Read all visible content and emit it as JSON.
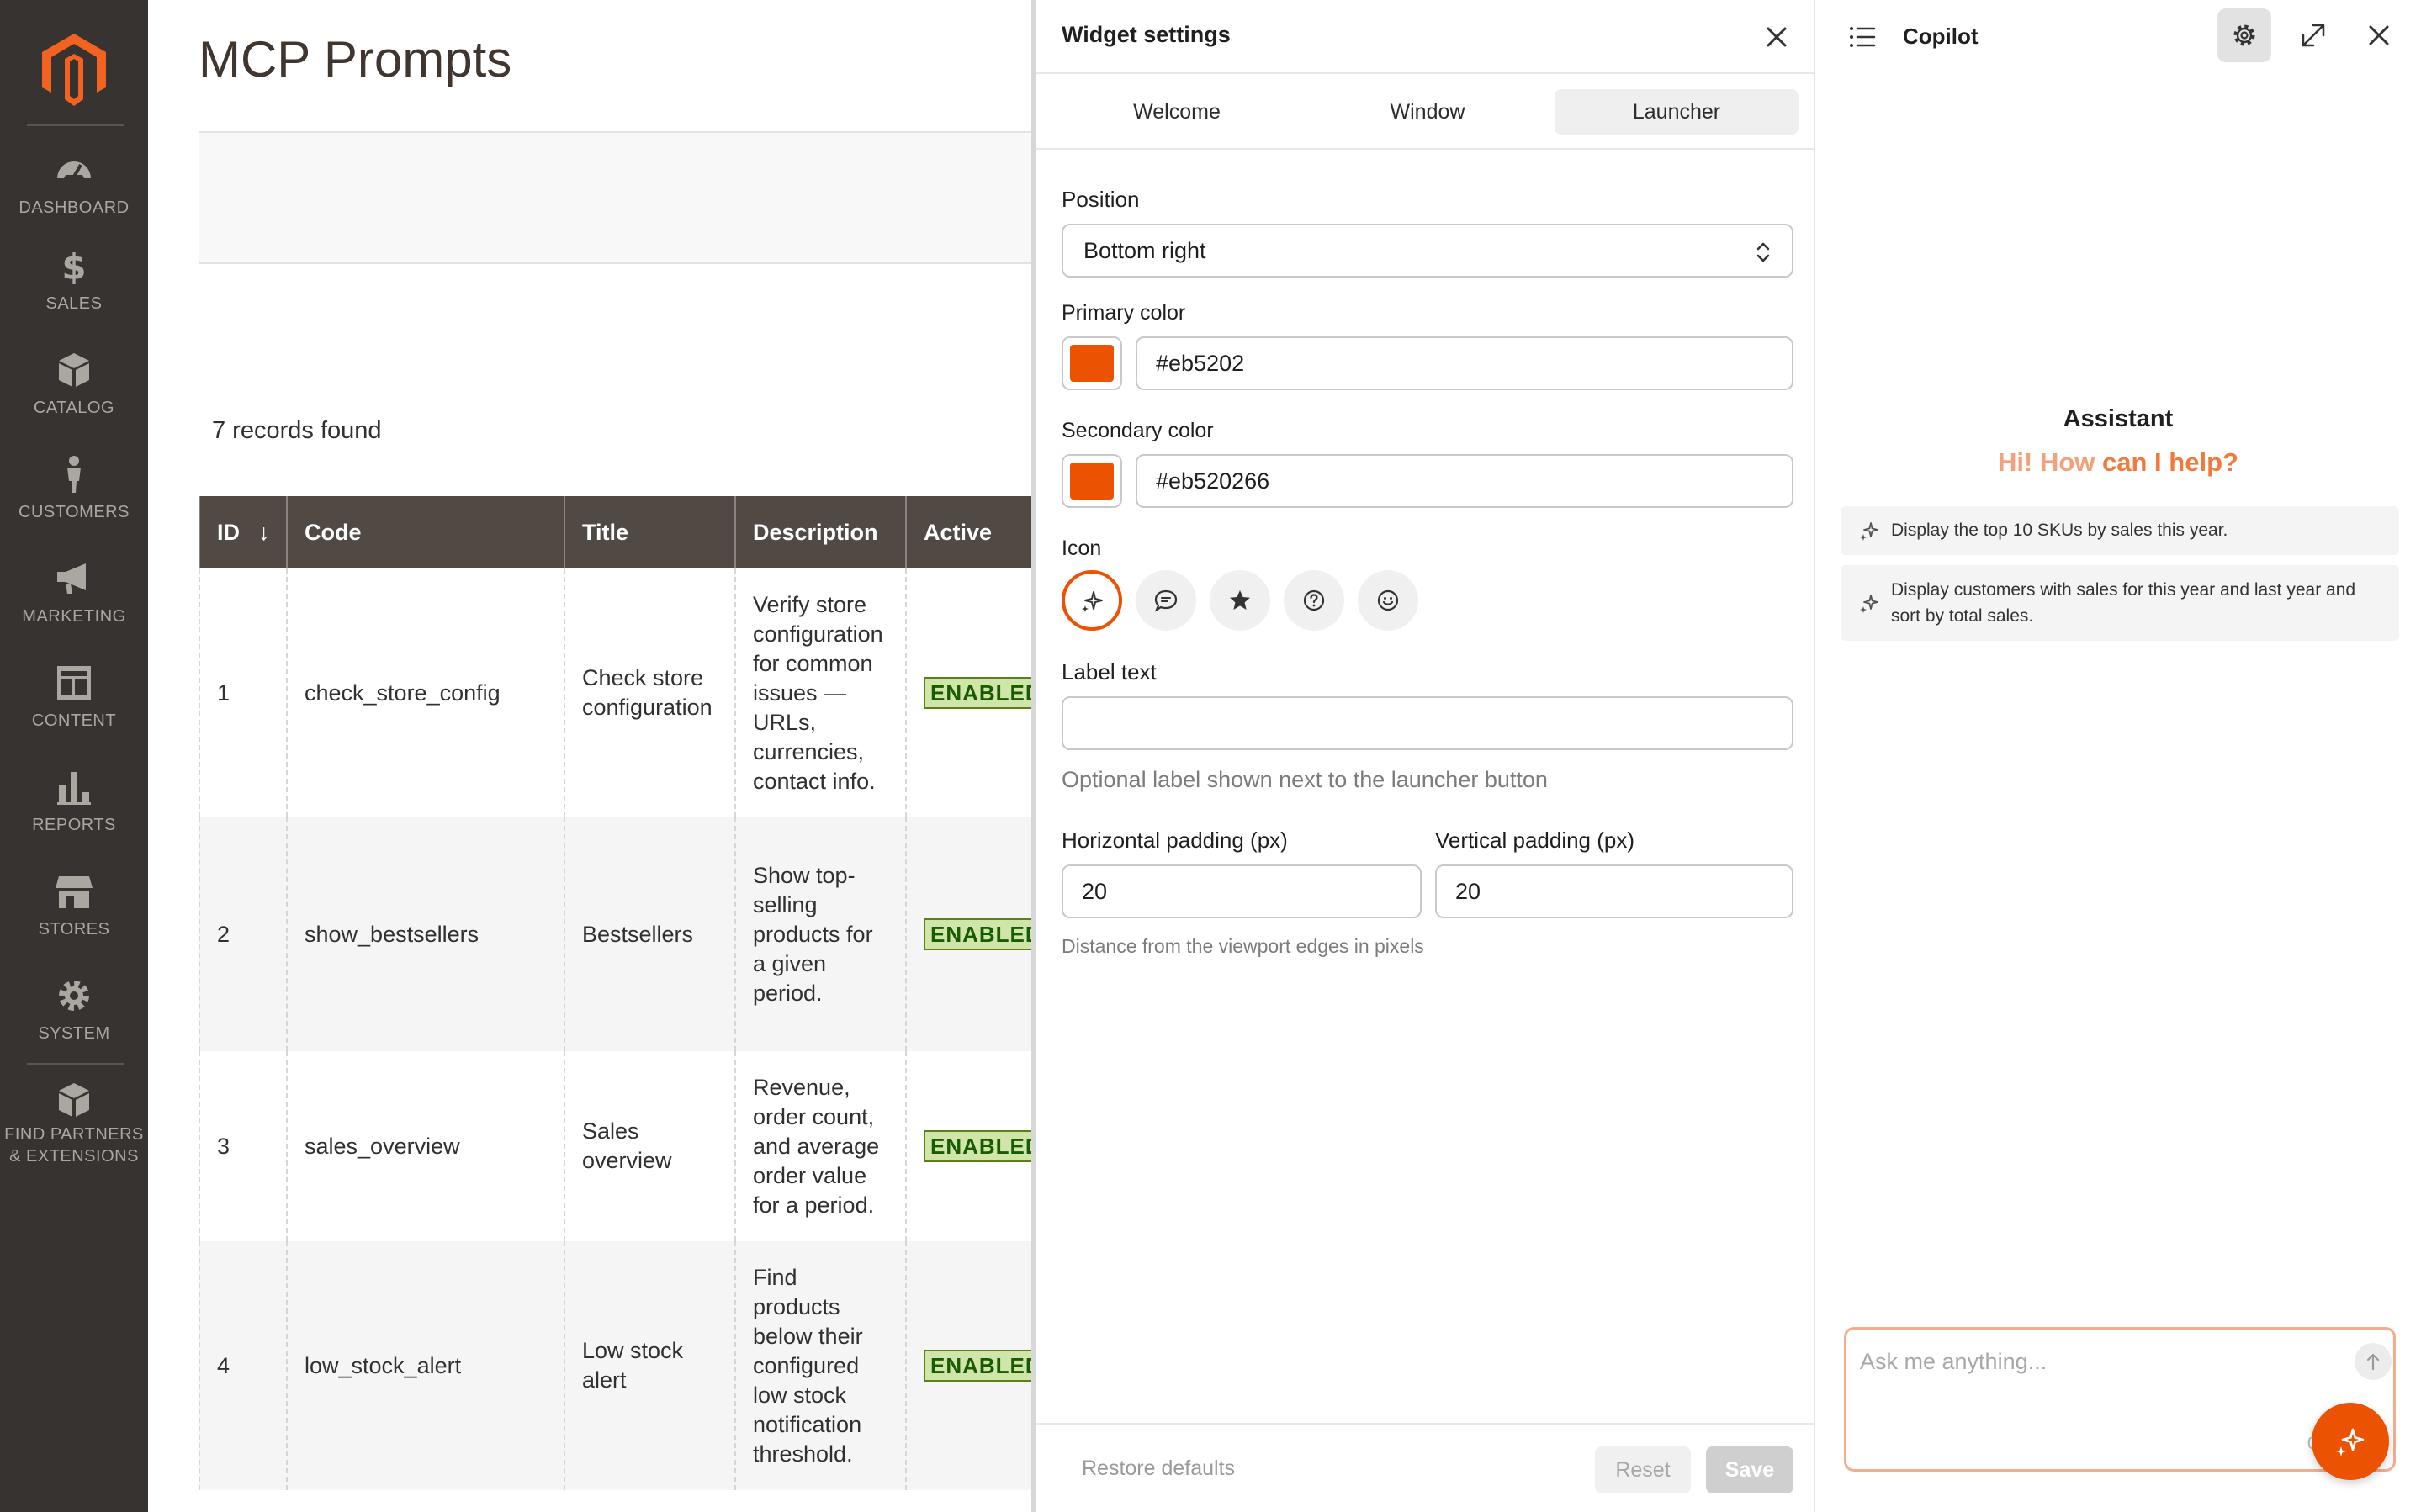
{
  "nav": {
    "items": [
      {
        "label": "DASHBOARD",
        "icon": "dashboard-icon"
      },
      {
        "label": "SALES",
        "icon": "dollar-icon"
      },
      {
        "label": "CATALOG",
        "icon": "box-icon"
      },
      {
        "label": "CUSTOMERS",
        "icon": "person-icon"
      },
      {
        "label": "MARKETING",
        "icon": "megaphone-icon"
      },
      {
        "label": "CONTENT",
        "icon": "layout-icon"
      },
      {
        "label": "REPORTS",
        "icon": "bar-chart-icon"
      },
      {
        "label": "STORES",
        "icon": "storefront-icon"
      },
      {
        "label": "SYSTEM",
        "icon": "gear-icon"
      }
    ],
    "partners": {
      "line1": "FIND PARTNERS",
      "line2": "& EXTENSIONS"
    }
  },
  "page": {
    "title": "MCP Prompts",
    "records": "7 records found"
  },
  "grid": {
    "columns": [
      "ID",
      "Code",
      "Title",
      "Description",
      "Active"
    ],
    "rows": [
      {
        "id": "1",
        "code": "check_store_config",
        "title": "Check store configuration",
        "description": "Verify store configuration for common issues — URLs, currencies, contact info.",
        "active": "ENABLED"
      },
      {
        "id": "2",
        "code": "show_bestsellers",
        "title": "Bestsellers",
        "description": "Show top-selling products for a given period.",
        "active": "ENABLED"
      },
      {
        "id": "3",
        "code": "sales_overview",
        "title": "Sales overview",
        "description": "Revenue, order count, and average order value for a period.",
        "active": "ENABLED"
      },
      {
        "id": "4",
        "code": "low_stock_alert",
        "title": "Low stock alert",
        "description": "Find products below their configured low stock notification threshold.",
        "active": "ENABLED"
      }
    ]
  },
  "widget": {
    "title": "Widget settings",
    "tabs": [
      "Welcome",
      "Window",
      "Launcher"
    ],
    "active_tab": "Launcher",
    "position_label": "Position",
    "position_value": "Bottom right",
    "primary_label": "Primary color",
    "primary_value": "#eb5202",
    "secondary_label": "Secondary color",
    "secondary_value": "#eb520266",
    "icon_label": "Icon",
    "icon_options": [
      "sparkle-icon",
      "chat-bubble-icon",
      "star-icon",
      "help-circle-icon",
      "smile-icon"
    ],
    "selected_icon": "sparkle-icon",
    "label_text_label": "Label text",
    "label_text_value": "",
    "label_text_hint": "Optional label shown next to the launcher button",
    "hpad_label": "Horizontal padding (px)",
    "hpad_value": "20",
    "vpad_label": "Vertical padding (px)",
    "vpad_value": "20",
    "padding_hint": "Distance from the viewport edges in pixels",
    "restore_label": "Restore defaults",
    "reset_label": "Reset",
    "save_label": "Save"
  },
  "copilot": {
    "title": "Copilot",
    "assistant_name": "Assistant",
    "greeting_part1": "Hi! How ",
    "greeting_part2": "can I help?",
    "suggestions": [
      "Display the top 10 SKUs by sales this year.",
      "Display customers with sales for this year and last year and sort by total sales."
    ],
    "input_placeholder": "Ask me anything...",
    "input_value": "",
    "counter": "0/5"
  },
  "colors": {
    "nav_bg": "#373330",
    "grid_header": "#514943",
    "accent": "#eb5202",
    "badge_bg": "#d0e5a9",
    "badge_text": "#185b00"
  }
}
